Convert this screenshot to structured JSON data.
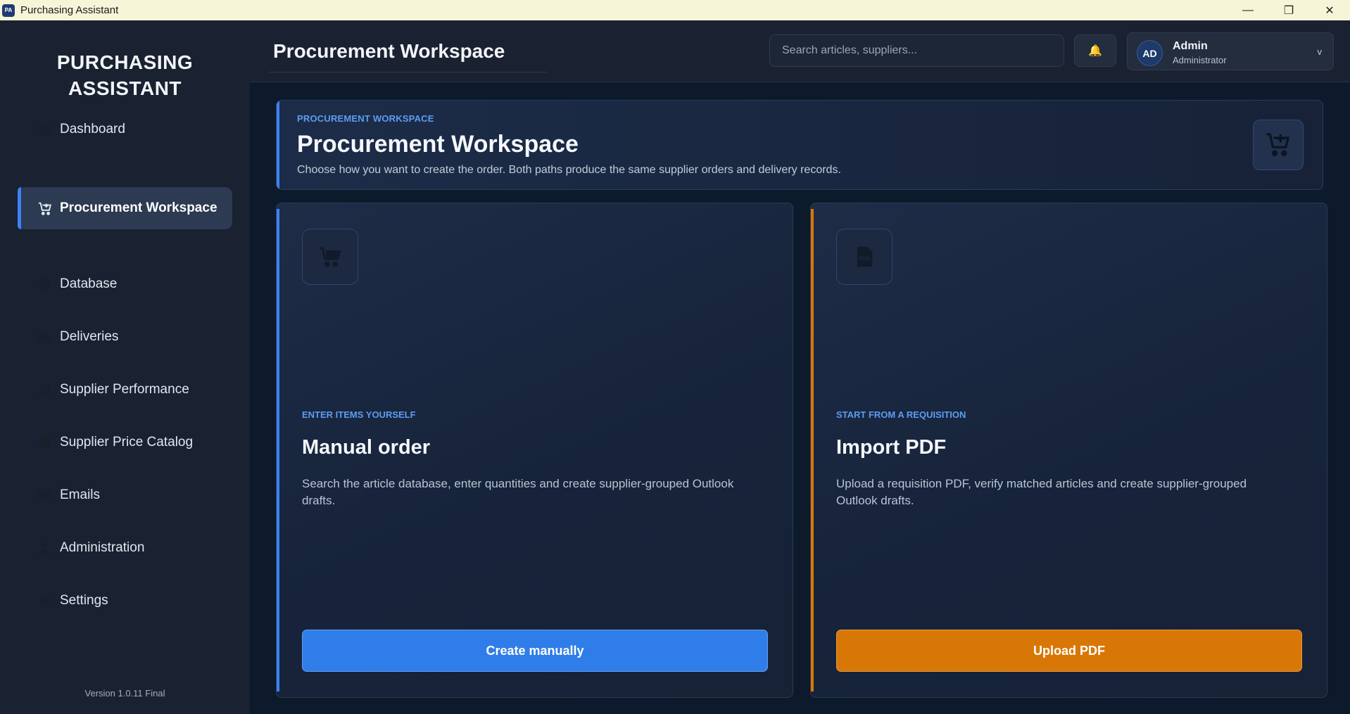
{
  "window": {
    "title": "Purchasing Assistant",
    "app_icon_text": "PA",
    "controls": {
      "minimize": "—",
      "maximize": "❐",
      "close": "✕"
    }
  },
  "sidebar": {
    "brand_line1": "PURCHASING",
    "brand_line2": "ASSISTANT",
    "items": [
      {
        "label": "Dashboard",
        "icon": "dashboard-icon",
        "active": false
      },
      {
        "label": "Procurement Workspace",
        "icon": "cart-plus-icon",
        "active": true
      },
      {
        "label": "Database",
        "icon": "database-icon",
        "active": false
      },
      {
        "label": "Deliveries",
        "icon": "truck-icon",
        "active": false
      },
      {
        "label": "Supplier Performance",
        "icon": "chart-icon",
        "active": false
      },
      {
        "label": "Supplier Price Catalog",
        "icon": "catalog-icon",
        "active": false
      },
      {
        "label": "Emails",
        "icon": "mail-icon",
        "active": false
      },
      {
        "label": "Administration",
        "icon": "admin-icon",
        "active": false
      },
      {
        "label": "Settings",
        "icon": "gear-icon",
        "active": false
      }
    ],
    "version": "Version 1.0.11 Final"
  },
  "header": {
    "title": "Procurement Workspace",
    "search_placeholder": "Search articles, suppliers...",
    "bell_icon": "🔔",
    "user": {
      "initials": "AD",
      "name": "Admin",
      "role": "Administrator",
      "chevron": "v"
    }
  },
  "hero": {
    "kicker": "PROCUREMENT WORKSPACE",
    "title": "Procurement Workspace",
    "description": "Choose how you want to create the order. Both paths produce the same supplier orders and delivery records.",
    "icon": "cart-plus-icon"
  },
  "cards": [
    {
      "kicker": "ENTER ITEMS YOURSELF",
      "title": "Manual order",
      "description": "Search the article database, enter quantities and create supplier-grouped Outlook drafts.",
      "button": "Create manually",
      "icon": "cart-icon",
      "accent": "#3b82f6"
    },
    {
      "kicker": "START FROM A REQUISITION",
      "title": "Import PDF",
      "description": "Upload a requisition PDF, verify matched articles and create supplier-grouped Outlook drafts.",
      "button": "Upload PDF",
      "icon": "pdf-icon",
      "accent": "#d97706"
    }
  ]
}
